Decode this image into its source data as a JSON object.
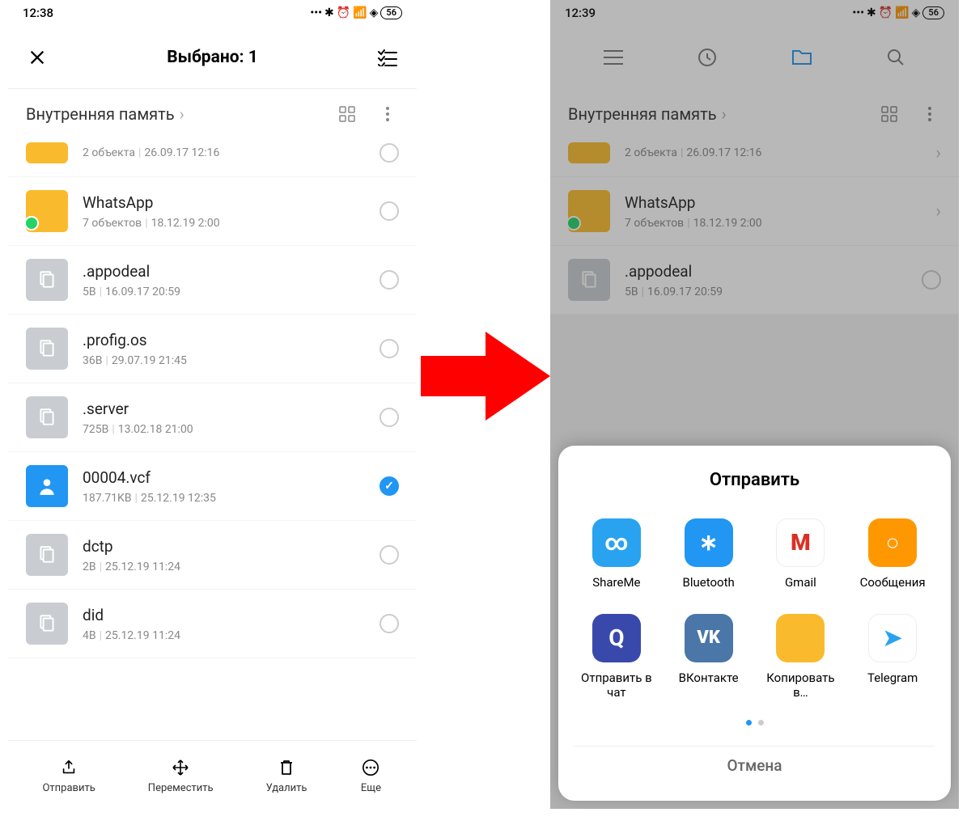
{
  "left": {
    "status": {
      "time": "12:38",
      "battery": "56"
    },
    "header": {
      "title": "Выбрано: 1"
    },
    "breadcrumb": "Внутренняя память",
    "items": [
      {
        "kind": "folder",
        "name": "",
        "meta1": "2 объекта",
        "meta2": "26.09.17 12:16",
        "checked": false
      },
      {
        "kind": "folder-wa",
        "name": "WhatsApp",
        "meta1": "7 объектов",
        "meta2": "18.12.19 2:00",
        "checked": false
      },
      {
        "kind": "file",
        "name": ".appodeal",
        "meta1": "5B",
        "meta2": "16.09.17 20:59",
        "checked": false
      },
      {
        "kind": "file",
        "name": ".profig.os",
        "meta1": "36B",
        "meta2": "29.07.19 21:45",
        "checked": false
      },
      {
        "kind": "file",
        "name": ".server",
        "meta1": "725B",
        "meta2": "13.02.18 21:00",
        "checked": false
      },
      {
        "kind": "contact",
        "name": "00004.vcf",
        "meta1": "187.71KB",
        "meta2": "25.12.19 12:35",
        "checked": true
      },
      {
        "kind": "file",
        "name": "dctp",
        "meta1": "2B",
        "meta2": "25.12.19 11:24",
        "checked": false
      },
      {
        "kind": "file",
        "name": "did",
        "meta1": "4B",
        "meta2": "25.12.19 11:24",
        "checked": false
      }
    ],
    "bottom": {
      "send": "Отправить",
      "move": "Переместить",
      "delete": "Удалить",
      "more": "Еще"
    }
  },
  "right": {
    "status": {
      "time": "12:39",
      "battery": "56"
    },
    "breadcrumb": "Внутренняя память",
    "items": [
      {
        "kind": "folder",
        "name": "",
        "meta1": "2 объекта",
        "meta2": "26.09.17 12:16"
      },
      {
        "kind": "folder-wa",
        "name": "WhatsApp",
        "meta1": "7 объектов",
        "meta2": "18.12.19 2:00"
      },
      {
        "kind": "file",
        "name": ".appodeal",
        "meta1": "5B",
        "meta2": "16.09.17 20:59"
      }
    ],
    "sheet": {
      "title": "Отправить",
      "apps": [
        {
          "label": "ShareMe",
          "bg": "#29a3ef",
          "glyph": "∞"
        },
        {
          "label": "Bluetooth",
          "bg": "#2196f3",
          "glyph": "∗"
        },
        {
          "label": "Gmail",
          "bg": "#ffffff",
          "glyph": "M"
        },
        {
          "label": "Сообщения",
          "bg": "#ff9800",
          "glyph": "○"
        },
        {
          "label": "Отправить в чат",
          "bg": "#3949ab",
          "glyph": "Q"
        },
        {
          "label": "ВКонтакте",
          "bg": "#4a76a8",
          "glyph": "VK"
        },
        {
          "label": "Копировать в…",
          "bg": "#f9bb2d",
          "glyph": ""
        },
        {
          "label": "Telegram",
          "bg": "#ffffff",
          "glyph": "➤"
        }
      ],
      "cancel": "Отмена"
    }
  }
}
